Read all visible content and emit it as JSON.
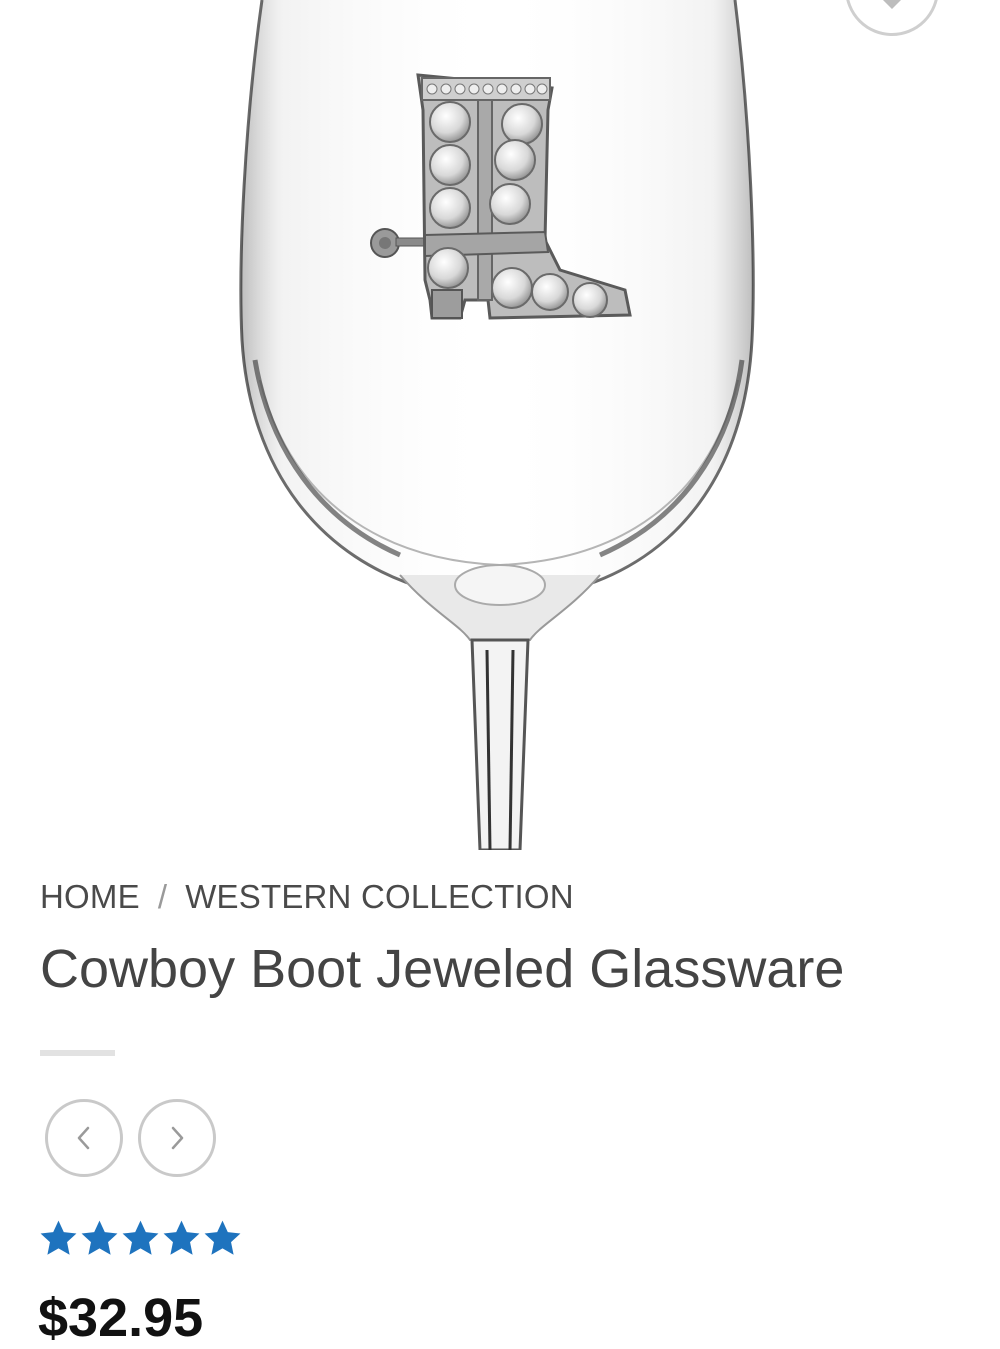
{
  "breadcrumb": {
    "home": "HOME",
    "separator": "/",
    "category": "WESTERN COLLECTION"
  },
  "product": {
    "title": "Cowboy Boot Jeweled Glassware",
    "rating": 5,
    "rating_max": 5,
    "price": "$32.95"
  },
  "icons": {
    "wishlist": "heart-icon",
    "prev": "chevron-left-icon",
    "next": "chevron-right-icon",
    "star": "star-icon"
  },
  "colors": {
    "star": "#1e73be",
    "text": "#444444",
    "border": "#c9c9c9"
  }
}
